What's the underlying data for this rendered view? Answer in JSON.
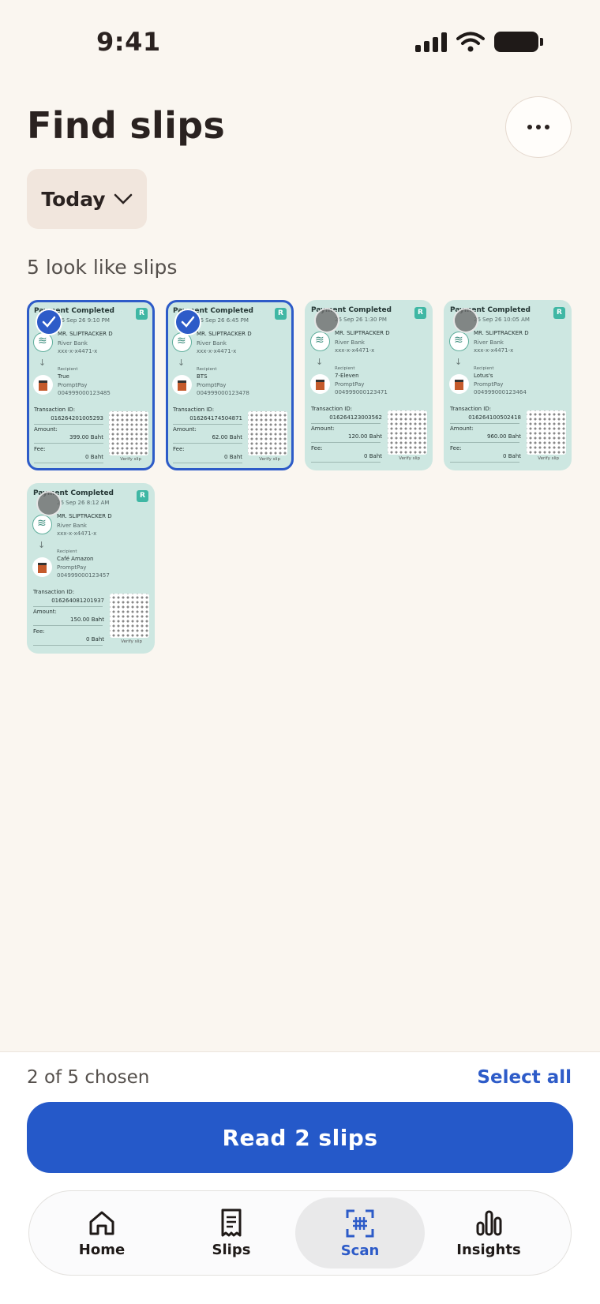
{
  "status": {
    "time": "9:41"
  },
  "header": {
    "title": "Find slips",
    "more_icon": "ellipsis-icon"
  },
  "filter": {
    "date_label": "Today"
  },
  "results": {
    "summary": "5 look like slips"
  },
  "slips": [
    {
      "header": "Payment Completed",
      "date": "26 Sep 26",
      "time": "9:10 PM",
      "sender": "MR. SLIPTRACKER D",
      "bank": "River Bank",
      "account": "xxx-x-x4471-x",
      "recipient_label": "Recipient",
      "recipient": "True",
      "method": "PromptPay",
      "ref": "004999000123485",
      "txn_label": "Transaction ID:",
      "txn_id": "016264201005293",
      "amount_label": "Amount:",
      "amount": "399.00 Baht",
      "fee_label": "Fee:",
      "fee": "0 Baht",
      "verify": "Verify slip",
      "badge": "R",
      "selected": true
    },
    {
      "header": "Payment Completed",
      "date": "26 Sep 26",
      "time": "6:45 PM",
      "sender": "MR. SLIPTRACKER D",
      "bank": "River Bank",
      "account": "xxx-x-x4471-x",
      "recipient_label": "Recipient",
      "recipient": "BTS",
      "method": "PromptPay",
      "ref": "004999000123478",
      "txn_label": "Transaction ID:",
      "txn_id": "016264174504871",
      "amount_label": "Amount:",
      "amount": "62.00 Baht",
      "fee_label": "Fee:",
      "fee": "0 Baht",
      "verify": "Verify slip",
      "badge": "R",
      "selected": true
    },
    {
      "header": "Payment Completed",
      "date": "26 Sep 26",
      "time": "1:30 PM",
      "sender": "MR. SLIPTRACKER D",
      "bank": "River Bank",
      "account": "xxx-x-x4471-x",
      "recipient_label": "Recipient",
      "recipient": "7-Eleven",
      "method": "PromptPay",
      "ref": "004999000123471",
      "txn_label": "Transaction ID:",
      "txn_id": "016264123003562",
      "amount_label": "Amount:",
      "amount": "120.00 Baht",
      "fee_label": "Fee:",
      "fee": "0 Baht",
      "verify": "Verify slip",
      "badge": "R",
      "selected": false
    },
    {
      "header": "Payment Completed",
      "date": "26 Sep 26",
      "time": "10:05 AM",
      "sender": "MR. SLIPTRACKER D",
      "bank": "River Bank",
      "account": "xxx-x-x4471-x",
      "recipient_label": "Recipient",
      "recipient": "Lotus's",
      "method": "PromptPay",
      "ref": "004999000123464",
      "txn_label": "Transaction ID:",
      "txn_id": "016264100502418",
      "amount_label": "Amount:",
      "amount": "960.00 Baht",
      "fee_label": "Fee:",
      "fee": "0 Baht",
      "verify": "Verify slip",
      "badge": "R",
      "selected": false
    },
    {
      "header": "Payment Completed",
      "date": "26 Sep 26",
      "time": "8:12 AM",
      "sender": "MR. SLIPTRACKER D",
      "bank": "River Bank",
      "account": "xxx-x-x4471-x",
      "recipient_label": "Recipient",
      "recipient": "Café Amazon",
      "method": "PromptPay",
      "ref": "004999000123457",
      "txn_label": "Transaction ID:",
      "txn_id": "016264081201937",
      "amount_label": "Amount:",
      "amount": "150.00 Baht",
      "fee_label": "Fee:",
      "fee": "0 Baht",
      "verify": "Verify slip",
      "badge": "R",
      "selected": false
    }
  ],
  "footer": {
    "chosen": "2 of 5 chosen",
    "select_all": "Select all",
    "read_button": "Read 2 slips"
  },
  "tabs": [
    {
      "label": "Home",
      "icon": "home-icon",
      "active": false
    },
    {
      "label": "Slips",
      "icon": "receipt-icon",
      "active": false
    },
    {
      "label": "Scan",
      "icon": "scan-icon",
      "active": true
    },
    {
      "label": "Insights",
      "icon": "bar-chart-icon",
      "active": false
    }
  ],
  "colors": {
    "accent": "#2559c9",
    "background": "#faf6f0",
    "slip": "#cde7e1"
  }
}
